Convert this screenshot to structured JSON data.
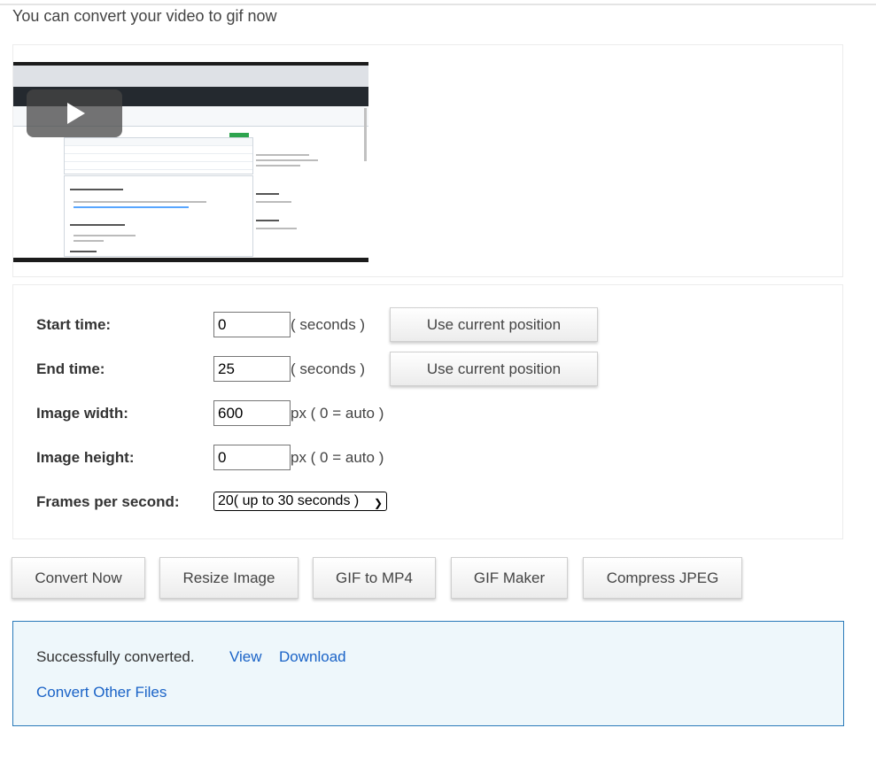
{
  "intro_text": "You can convert your video to gif now",
  "video": {
    "play_icon": "play-icon"
  },
  "form": {
    "start_time": {
      "label": "Start time:",
      "value": "0",
      "unit": "( seconds )",
      "button": "Use current position"
    },
    "end_time": {
      "label": "End time:",
      "value": "25",
      "unit": "( seconds )",
      "button": "Use current position"
    },
    "image_width": {
      "label": "Image width:",
      "value": "600",
      "unit": "px ( 0 = auto )"
    },
    "image_height": {
      "label": "Image height:",
      "value": "0",
      "unit": "px ( 0 = auto )"
    },
    "fps": {
      "label": "Frames per second:",
      "selected": "20( up to 30 seconds )",
      "chevron_icon": "chevron-down-icon"
    }
  },
  "actions": [
    "Convert Now",
    "Resize Image",
    "GIF to MP4",
    "GIF Maker",
    "Compress JPEG"
  ],
  "result": {
    "message": "Successfully converted.",
    "view_link": "View",
    "download_link": "Download",
    "convert_other_link": "Convert Other Files"
  },
  "colors": {
    "link": "#1a63c7",
    "result_border": "#2a7ab9",
    "result_bg": "#eef7fb"
  }
}
